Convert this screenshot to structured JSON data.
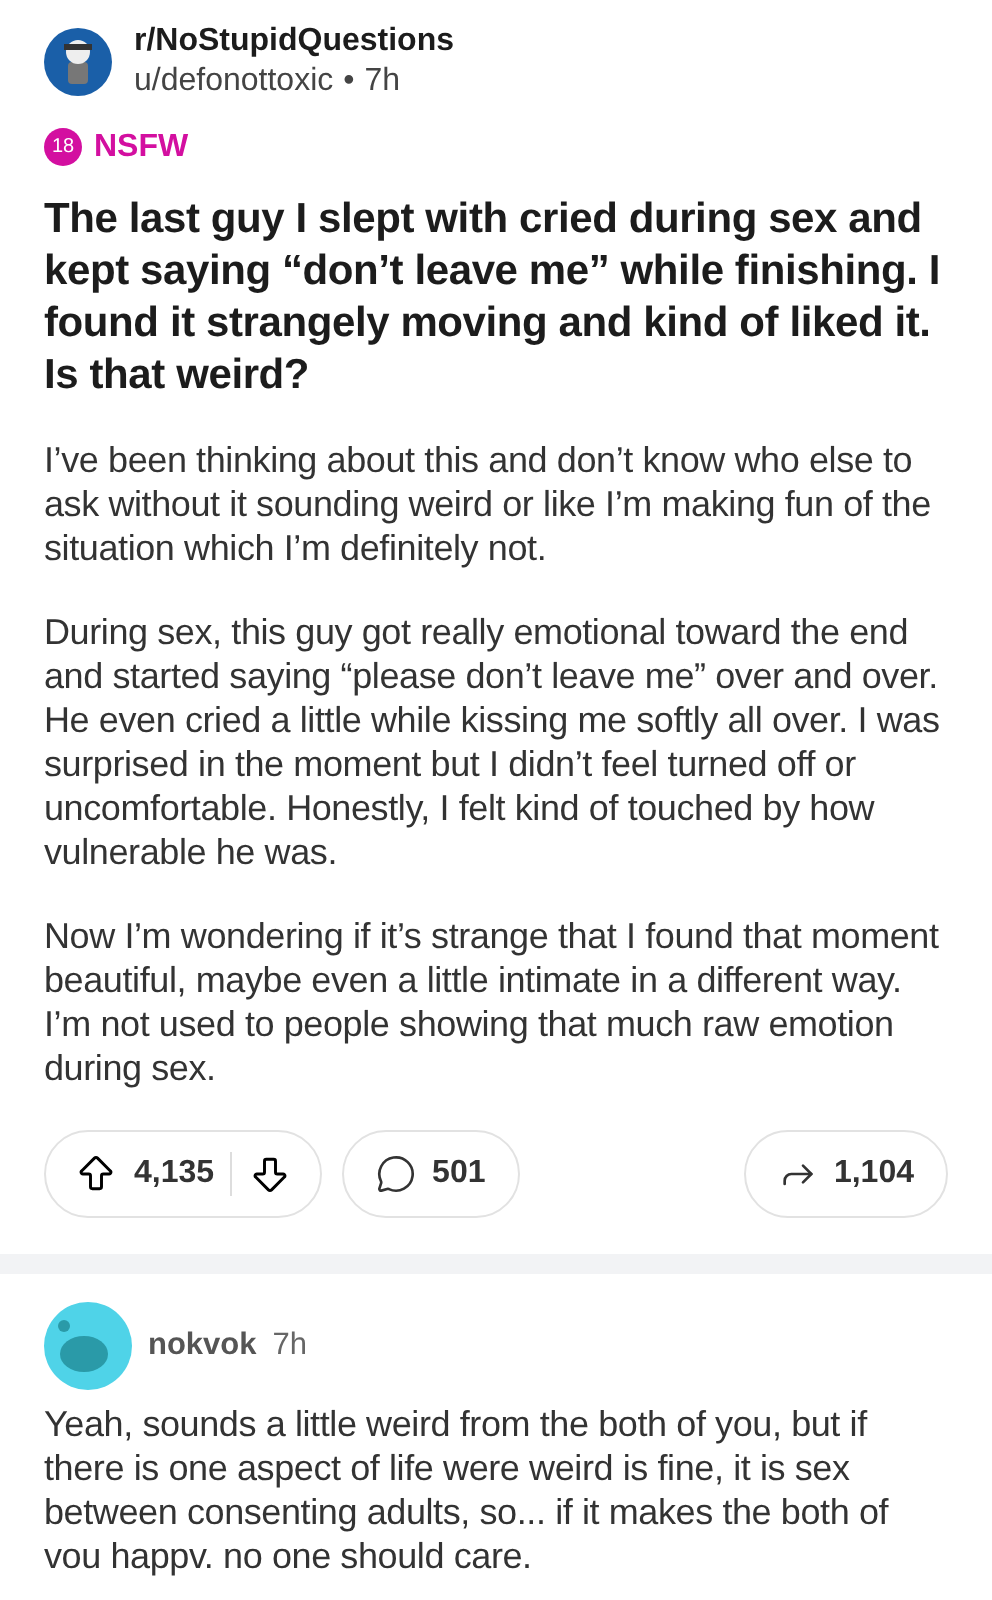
{
  "post": {
    "subreddit": "r/NoStupidQuestions",
    "author": "u/defonottoxic",
    "separator": "•",
    "time": "7h",
    "nsfw_badge": "18",
    "nsfw_label": "NSFW",
    "title": "The last guy I slept with cried during sex and kept saying “don’t leave me” while finishing. I found it strangely moving and kind of liked it. Is that weird?",
    "paragraphs": [
      "I’ve been thinking about this and don’t know who else to ask without it sounding weird or like I’m making fun of the situation which I’m definitely not.",
      "During sex, this guy got really emotional toward the end and started saying “please don’t leave me” over and over. He even cried a little while kissing me softly all over. I was surprised in the moment but I didn’t feel turned off or uncomfortable. Honestly, I felt kind of touched by how vulnerable he was.",
      "Now I’m wondering if it’s strange that I found that moment beautiful, maybe even a little intimate in a different way. I’m not used to people showing that much raw emotion during sex."
    ],
    "votes": "4,135",
    "comments": "501",
    "shares": "1,104"
  },
  "comment": {
    "author": "nokvok",
    "time": "7h",
    "text": "Yeah, sounds a little weird from the both of you, but if there is one aspect of life were weird is fine, it is sex between consenting adults, so... if it makes the both of vou happv. no one should care."
  }
}
